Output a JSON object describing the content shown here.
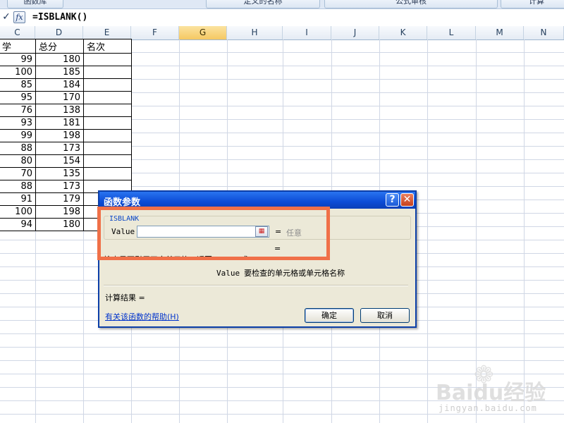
{
  "ribbon": {
    "items": [
      "函数库",
      "定义的名称",
      "公式审核",
      "计算"
    ]
  },
  "formula_bar": {
    "enter_glyph": "✓",
    "fx_label": "fx",
    "formula": "=ISBLANK()"
  },
  "columns": [
    "C",
    "D",
    "E",
    "F",
    "G",
    "H",
    "I",
    "J",
    "K",
    "L",
    "M",
    "N"
  ],
  "selected_column": "G",
  "table": {
    "headers": [
      "学",
      "总分",
      "名次"
    ],
    "rows": [
      [
        "99",
        "180",
        ""
      ],
      [
        "100",
        "185",
        ""
      ],
      [
        "85",
        "184",
        ""
      ],
      [
        "95",
        "170",
        ""
      ],
      [
        "76",
        "138",
        ""
      ],
      [
        "93",
        "181",
        ""
      ],
      [
        "99",
        "198",
        ""
      ],
      [
        "88",
        "173",
        ""
      ],
      [
        "80",
        "154",
        ""
      ],
      [
        "70",
        "135",
        ""
      ],
      [
        "88",
        "173",
        ""
      ],
      [
        "91",
        "179",
        ""
      ],
      [
        "100",
        "198",
        ""
      ],
      [
        "94",
        "180",
        ""
      ]
    ]
  },
  "dialog": {
    "title": "函数参数",
    "help_glyph": "?",
    "close_glyph": "✕",
    "function_name": "ISBLANK",
    "argument_label": "Value",
    "argument_value": "",
    "argument_eq": "=",
    "argument_type": "任意",
    "result_eq": "=",
    "description": "检查是否引用了空单元格，返回 TRUE 或 FALSE",
    "arg_desc_name": "Value",
    "arg_desc_text": "要检查的单元格或单元格名称",
    "calc_result": "计算结果 =",
    "help_link": "有关该函数的帮助(H)",
    "ok": "确定",
    "cancel": "取消"
  },
  "colors": {
    "highlight": "#f07048",
    "dialog_title": "#0b4bd6",
    "selected_col": "#f5c862"
  },
  "watermark": {
    "brand": "Baidu经验",
    "sub": "jingyan.baidu.com"
  }
}
